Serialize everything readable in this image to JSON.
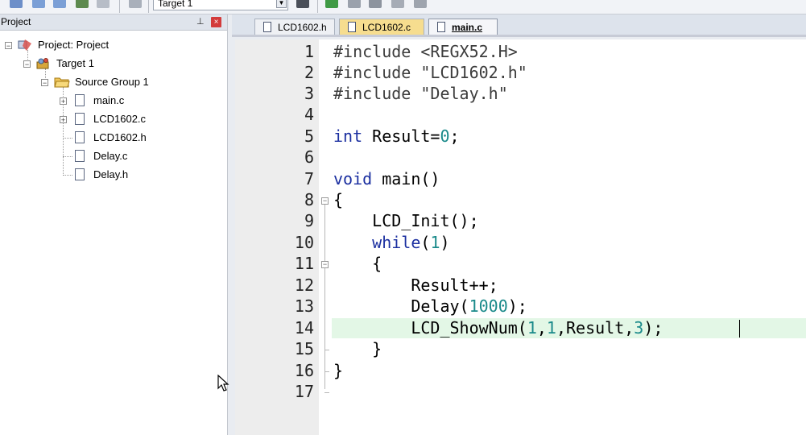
{
  "toolbar": {
    "target_value": "Target 1"
  },
  "project_panel": {
    "title": "Project",
    "pin_glyph": "⊥",
    "close_glyph": "×",
    "tree": {
      "project": "Project: Project",
      "target": "Target 1",
      "group": "Source Group 1",
      "files": [
        "main.c",
        "LCD1602.c",
        "LCD1602.h",
        "Delay.c",
        "Delay.h"
      ]
    }
  },
  "tabs": [
    {
      "label": "LCD1602.h",
      "active": false
    },
    {
      "label": "LCD1602.c",
      "active": false
    },
    {
      "label": "main.c",
      "active": true
    }
  ],
  "editor": {
    "line_numbers": [
      "1",
      "2",
      "3",
      "4",
      "5",
      "6",
      "7",
      "8",
      "9",
      "10",
      "11",
      "12",
      "13",
      "14",
      "15",
      "16",
      "17"
    ],
    "highlighted_line": 14,
    "colors": {
      "keyword": "#1b2fa0",
      "number": "#1a8a8a",
      "highlight": "#e3f7e6"
    },
    "code": {
      "l1_directive": "#include",
      "l1_arg": "<REGX52.H>",
      "l2_directive": "#include",
      "l2_arg": "\"LCD1602.h\"",
      "l3_directive": "#include",
      "l3_arg": "\"Delay.h\"",
      "l5_kw": "int",
      "l5_rest": "Result=",
      "l5_num": "0",
      "l5_end": ";",
      "l7_kw": "void",
      "l7_rest": "main()",
      "l8": "{",
      "l9": "LCD_Init();",
      "l10_kw": "while",
      "l10_a": "(",
      "l10_num": "1",
      "l10_b": ")",
      "l11": "{",
      "l12": "Result++;",
      "l13_a": "Delay(",
      "l13_num": "1000",
      "l13_b": ");",
      "l14_a": "LCD_ShowNum(",
      "l14_n1": "1",
      "l14_c1": ",",
      "l14_n2": "1",
      "l14_b": ",Result,",
      "l14_n3": "3",
      "l14_end": ");",
      "l15": "}",
      "l16": "}"
    }
  }
}
